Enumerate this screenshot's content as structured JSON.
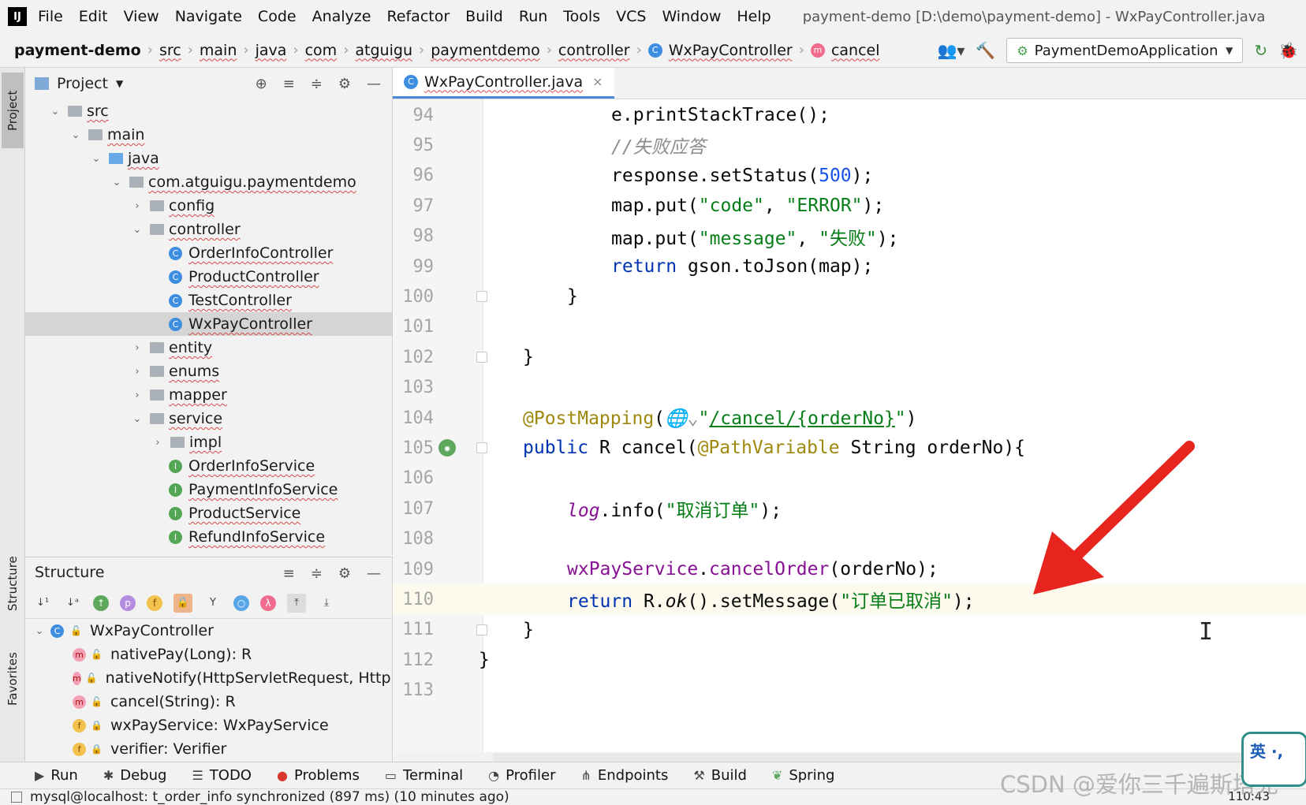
{
  "menubar": {
    "logo": "IJ",
    "items": [
      "File",
      "Edit",
      "View",
      "Navigate",
      "Code",
      "Analyze",
      "Refactor",
      "Build",
      "Run",
      "Tools",
      "VCS",
      "Window",
      "Help"
    ],
    "window_title": "payment-demo [D:\\demo\\payment-demo] - WxPayController.java"
  },
  "navbar": {
    "crumbs": [
      "payment-demo",
      "src",
      "main",
      "java",
      "com",
      "atguigu",
      "paymentdemo",
      "controller"
    ],
    "class_crumb": "WxPayController",
    "method_crumb": "cancel",
    "run_config": "PaymentDemoApplication"
  },
  "left_strip": {
    "project_tab": "Project",
    "structure_tab": "Structure",
    "favorites_tab": "Favorites"
  },
  "project_panel": {
    "title": "Project",
    "tree": [
      {
        "label": "src",
        "indent": 0,
        "arrow": "down",
        "icon": "folder"
      },
      {
        "label": "main",
        "indent": 1,
        "arrow": "down",
        "icon": "folder"
      },
      {
        "label": "java",
        "indent": 2,
        "arrow": "down",
        "icon": "folder-blue"
      },
      {
        "label": "com.atguigu.paymentdemo",
        "indent": 3,
        "arrow": "down",
        "icon": "folder"
      },
      {
        "label": "config",
        "indent": 4,
        "arrow": "right",
        "icon": "folder"
      },
      {
        "label": "controller",
        "indent": 4,
        "arrow": "down",
        "icon": "folder"
      },
      {
        "label": "OrderInfoController",
        "indent": 5,
        "arrow": "",
        "icon": "class"
      },
      {
        "label": "ProductController",
        "indent": 5,
        "arrow": "",
        "icon": "class"
      },
      {
        "label": "TestController",
        "indent": 5,
        "arrow": "",
        "icon": "class"
      },
      {
        "label": "WxPayController",
        "indent": 5,
        "arrow": "",
        "icon": "class",
        "selected": true
      },
      {
        "label": "entity",
        "indent": 4,
        "arrow": "right",
        "icon": "folder"
      },
      {
        "label": "enums",
        "indent": 4,
        "arrow": "right",
        "icon": "folder"
      },
      {
        "label": "mapper",
        "indent": 4,
        "arrow": "right",
        "icon": "folder"
      },
      {
        "label": "service",
        "indent": 4,
        "arrow": "down",
        "icon": "folder"
      },
      {
        "label": "impl",
        "indent": 5,
        "arrow": "right",
        "icon": "folder"
      },
      {
        "label": "OrderInfoService",
        "indent": 5,
        "arrow": "",
        "icon": "interface"
      },
      {
        "label": "PaymentInfoService",
        "indent": 5,
        "arrow": "",
        "icon": "interface"
      },
      {
        "label": "ProductService",
        "indent": 5,
        "arrow": "",
        "icon": "interface"
      },
      {
        "label": "RefundInfoService",
        "indent": 5,
        "arrow": "",
        "icon": "interface"
      }
    ]
  },
  "structure_panel": {
    "title": "Structure",
    "root": "WxPayController",
    "members": [
      {
        "kind": "m",
        "access": "public",
        "label": "nativePay(Long): R"
      },
      {
        "kind": "m",
        "access": "public",
        "label": "nativeNotify(HttpServletRequest, HttpSer"
      },
      {
        "kind": "m",
        "access": "public",
        "label": "cancel(String): R"
      },
      {
        "kind": "f",
        "access": "private",
        "label": "wxPayService: WxPayService"
      },
      {
        "kind": "f",
        "access": "private",
        "label": "verifier: Verifier"
      }
    ]
  },
  "editor": {
    "tab_label": "WxPayController.java",
    "current_line": 110,
    "lines": [
      {
        "n": "94",
        "html_key": "l94"
      },
      {
        "n": "95",
        "html_key": "l95"
      },
      {
        "n": "96",
        "html_key": "l96"
      },
      {
        "n": "97",
        "html_key": "l97"
      },
      {
        "n": "98",
        "html_key": "l98"
      },
      {
        "n": "99",
        "html_key": "l99"
      },
      {
        "n": "100",
        "html_key": "l100"
      },
      {
        "n": "101",
        "html_key": "l101"
      },
      {
        "n": "102",
        "html_key": "l102"
      },
      {
        "n": "103",
        "html_key": "l103"
      },
      {
        "n": "104",
        "html_key": "l104"
      },
      {
        "n": "105",
        "html_key": "l105"
      },
      {
        "n": "106",
        "html_key": "l106"
      },
      {
        "n": "107",
        "html_key": "l107"
      },
      {
        "n": "108",
        "html_key": "l108"
      },
      {
        "n": "109",
        "html_key": "l109"
      },
      {
        "n": "110",
        "html_key": "l110"
      },
      {
        "n": "111",
        "html_key": "l111"
      },
      {
        "n": "112",
        "html_key": "l112"
      },
      {
        "n": "113",
        "html_key": "l113"
      }
    ],
    "code": {
      "l94": "e.printStackTrace();",
      "l95": "//失败应答",
      "l96_a": "response.setStatus(",
      "l96_num": "500",
      "l96_b": ");",
      "l97_a": "map.put(",
      "l97_s1": "\"code\"",
      "l97_c": ", ",
      "l97_s2": "\"ERROR\"",
      "l97_b": ");",
      "l98_a": "map.put(",
      "l98_s1": "\"message\"",
      "l98_c": ", ",
      "l98_s2": "\"失败\"",
      "l98_b": ");",
      "l99_kw": "return",
      "l99_rest": " gson.toJson(map);",
      "l100": "}",
      "l102": "}",
      "l104_ann": "@PostMapping",
      "l104_p": "(",
      "l104_globe": "🌐⌄",
      "l104_q1": "\"",
      "l104_url": "/cancel/{orderNo}",
      "l104_q2": "\"",
      "l104_e": ")",
      "l105_kw": "public",
      "l105_a": " R ",
      "l105_m": "cancel",
      "l105_p": "(",
      "l105_ann": "@PathVariable",
      "l105_rest": " String orderNo){",
      "l107_log": "log",
      "l107_a": ".info(",
      "l107_s": "\"取消订单\"",
      "l107_b": ");",
      "l109_fld": "wxPayService",
      "l109_dot": ".",
      "l109_m": "cancelOrder",
      "l109_rest": "(orderNo);",
      "l110_kw": "return",
      "l110_a": " R.",
      "l110_ok": "ok",
      "l110_b": "().setMessage(",
      "l110_s": "\"订单已取消\"",
      "l110_c": ");",
      "l111": "}",
      "l112": "}"
    }
  },
  "bottom_bar": {
    "items": [
      {
        "icon": "run-icon",
        "label": "Run"
      },
      {
        "icon": "debug-icon",
        "label": "Debug"
      },
      {
        "icon": "todo-icon",
        "label": "TODO"
      },
      {
        "icon": "problems-icon",
        "label": "Problems"
      },
      {
        "icon": "terminal-icon",
        "label": "Terminal"
      },
      {
        "icon": "profiler-icon",
        "label": "Profiler"
      },
      {
        "icon": "endpoints-icon",
        "label": "Endpoints"
      },
      {
        "icon": "build-icon",
        "label": "Build"
      },
      {
        "icon": "spring-icon",
        "label": "Spring"
      }
    ]
  },
  "status_bar": {
    "message": "mysql@localhost: t_order_info synchronized (897 ms) (10 minutes ago)",
    "position": "110:43"
  },
  "overlay": {
    "watermark": "CSDN @爱你三千遍斯塔克",
    "ime_label": "英 ·,",
    "arrow_color": "#e8241e"
  }
}
